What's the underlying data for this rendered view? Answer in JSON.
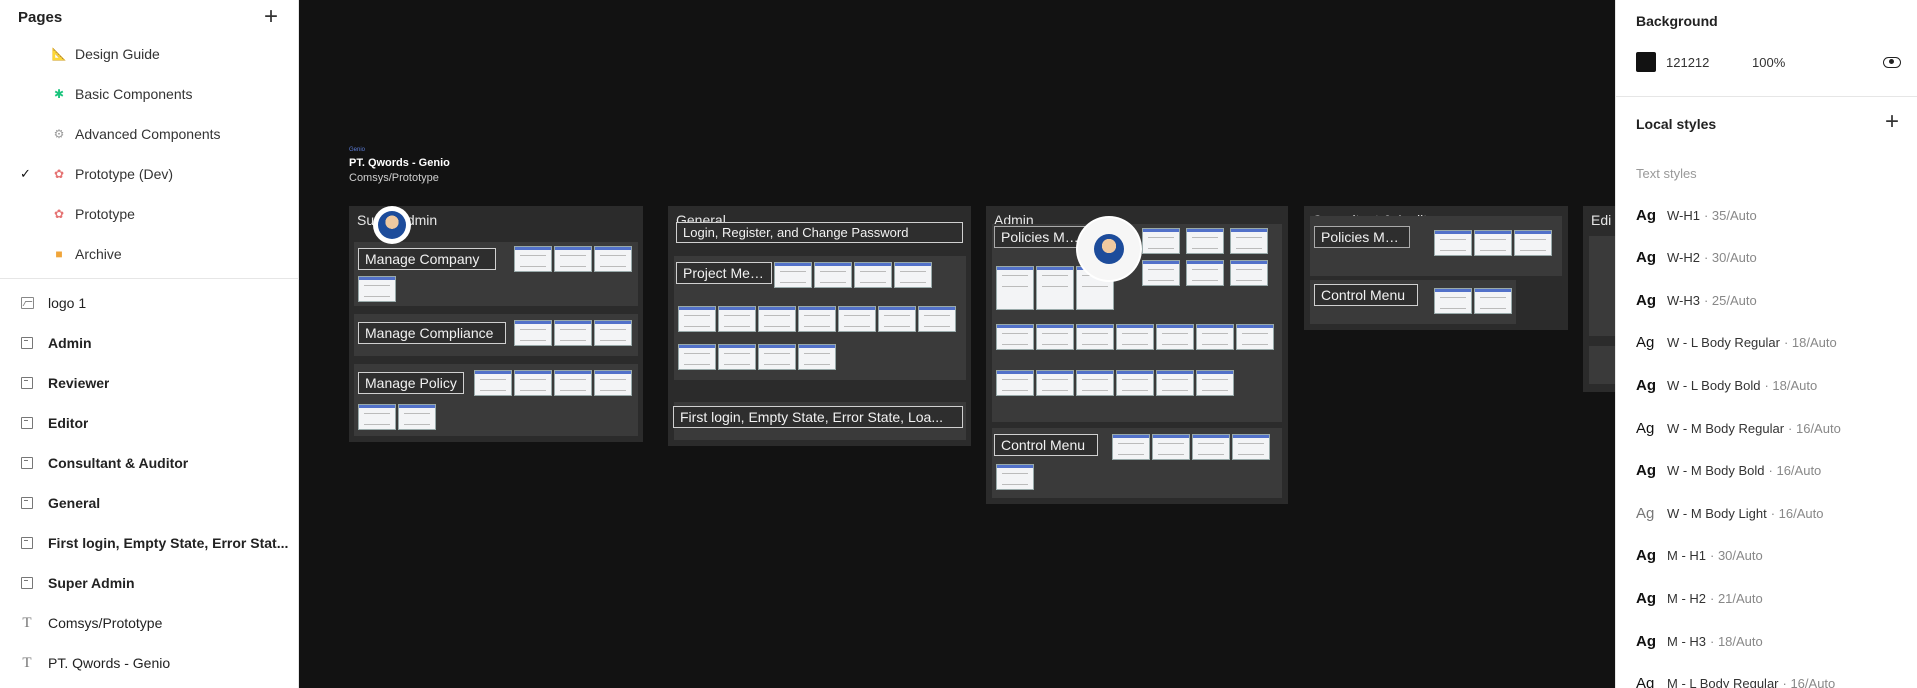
{
  "left_panel": {
    "pages_title": "Pages",
    "add_label": "+",
    "pages": [
      {
        "label": "Design Guide",
        "icon": "triangle-ruler-icon",
        "glyph": "📐",
        "checked": false
      },
      {
        "label": "Basic Components",
        "icon": "component-icon",
        "glyph": "✱",
        "checked": false
      },
      {
        "label": "Advanced Components",
        "icon": "gear-icon",
        "glyph": "⚙",
        "checked": false
      },
      {
        "label": "Prototype (Dev)",
        "icon": "pink-sparkle-icon",
        "glyph": "✿",
        "checked": true
      },
      {
        "label": "Prototype",
        "icon": "pink-sparkle-icon",
        "glyph": "✿",
        "checked": false
      },
      {
        "label": "Archive",
        "icon": "box-icon",
        "glyph": "■",
        "checked": false
      }
    ],
    "check_glyph": "✓",
    "layers": [
      {
        "label": "logo 1",
        "type": "image",
        "bold": false
      },
      {
        "label": "Admin",
        "type": "frame",
        "bold": true
      },
      {
        "label": "Reviewer",
        "type": "frame",
        "bold": true
      },
      {
        "label": "Editor",
        "type": "frame",
        "bold": true
      },
      {
        "label": "Consultant & Auditor",
        "type": "frame",
        "bold": true
      },
      {
        "label": "General",
        "type": "frame",
        "bold": true
      },
      {
        "label": "First login, Empty State, Error Stat...",
        "type": "frame",
        "bold": true
      },
      {
        "label": "Super Admin",
        "type": "frame",
        "bold": true
      },
      {
        "label": "Comsys/Prototype",
        "type": "text",
        "bold": false
      },
      {
        "label": "PT. Qwords - Genio",
        "type": "text",
        "bold": false
      }
    ]
  },
  "canvas": {
    "logo_text": "Genio",
    "project_title": "PT. Qwords - Genio",
    "project_subtitle": "Comsys/Prototype",
    "sections": {
      "super_admin": "Super Admin",
      "general": "General",
      "admin": "Admin",
      "consultant": "Consultant & Auditor",
      "editor": "Edi"
    },
    "tags": {
      "manage_company": "Manage Company",
      "manage_compliance": "Manage Compliance",
      "manage_policy": "Manage Policy",
      "login_register": "Login, Register, and Change Password",
      "project_menu": "Project Menu",
      "first_login": "First login, Empty State, Error State, Loa...",
      "policies_menu": "Policies Menu",
      "control_menu_admin": "Control Menu",
      "policies_menu_consultant": "Policies Menu",
      "control_menu_consultant": "Control Menu"
    }
  },
  "right_panel": {
    "background_title": "Background",
    "bg_hex": "121212",
    "bg_opacity": "100%",
    "bg_color": "#121212",
    "local_styles_title": "Local styles",
    "text_styles_title": "Text styles",
    "ag": "Ag",
    "text_styles": [
      {
        "name": "W-H1",
        "meta": "· 35/Auto",
        "weight": "bold"
      },
      {
        "name": "W-H2",
        "meta": "· 30/Auto",
        "weight": "bold"
      },
      {
        "name": "W-H3",
        "meta": "· 25/Auto",
        "weight": "bold"
      },
      {
        "name": "W - L Body Regular",
        "meta": "· 18/Auto",
        "weight": "normal"
      },
      {
        "name": "W - L Body Bold",
        "meta": "· 18/Auto",
        "weight": "bold"
      },
      {
        "name": "W - M Body Regular",
        "meta": "· 16/Auto",
        "weight": "normal"
      },
      {
        "name": "W - M Body Bold",
        "meta": "· 16/Auto",
        "weight": "bold"
      },
      {
        "name": "W - M Body Light",
        "meta": "· 16/Auto",
        "weight": "light"
      },
      {
        "name": "M - H1",
        "meta": "· 30/Auto",
        "weight": "bold"
      },
      {
        "name": "M - H2",
        "meta": "· 21/Auto",
        "weight": "bold"
      },
      {
        "name": "M - H3",
        "meta": "· 18/Auto",
        "weight": "bold"
      },
      {
        "name": "M - L Body Regular",
        "meta": "· 16/Auto",
        "weight": "normal"
      }
    ]
  }
}
